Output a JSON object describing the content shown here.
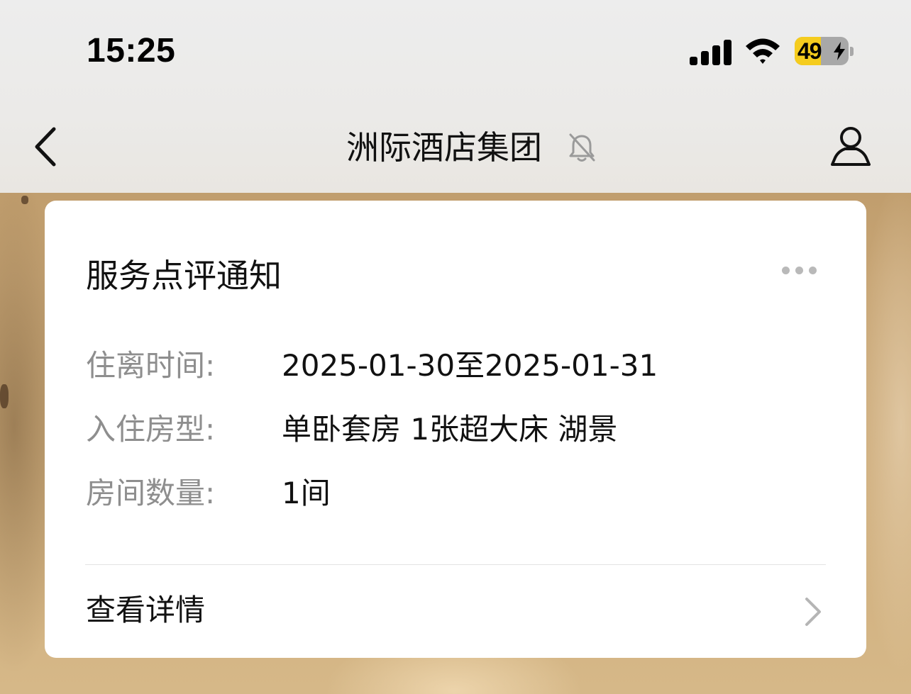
{
  "status_bar": {
    "time": "15:25",
    "battery_level": "49",
    "battery_fraction": 0.49,
    "charging": true,
    "icons": [
      "signal-icon",
      "wifi-icon",
      "battery-icon",
      "bolt-icon"
    ]
  },
  "header": {
    "title": "洲际酒店集团",
    "muted": true,
    "icons": [
      "chevron-left-icon",
      "bell-off-icon",
      "person-icon"
    ]
  },
  "message_card": {
    "title": "服务点评通知",
    "fields": [
      {
        "label": "住离时间:",
        "value": "2025-01-30至2025-01-31"
      },
      {
        "label": "入住房型:",
        "value": "单卧套房 1张超大床 湖景"
      },
      {
        "label": "房间数量:",
        "value": "1间"
      }
    ],
    "link_label": "查看详情",
    "icons": [
      "more-icon",
      "chevron-right-icon"
    ]
  },
  "colors": {
    "accent_battery": "#f5cc1e",
    "label_gray": "#8e8e8e",
    "text_dark": "#111111",
    "card_bg": "#ffffff"
  }
}
